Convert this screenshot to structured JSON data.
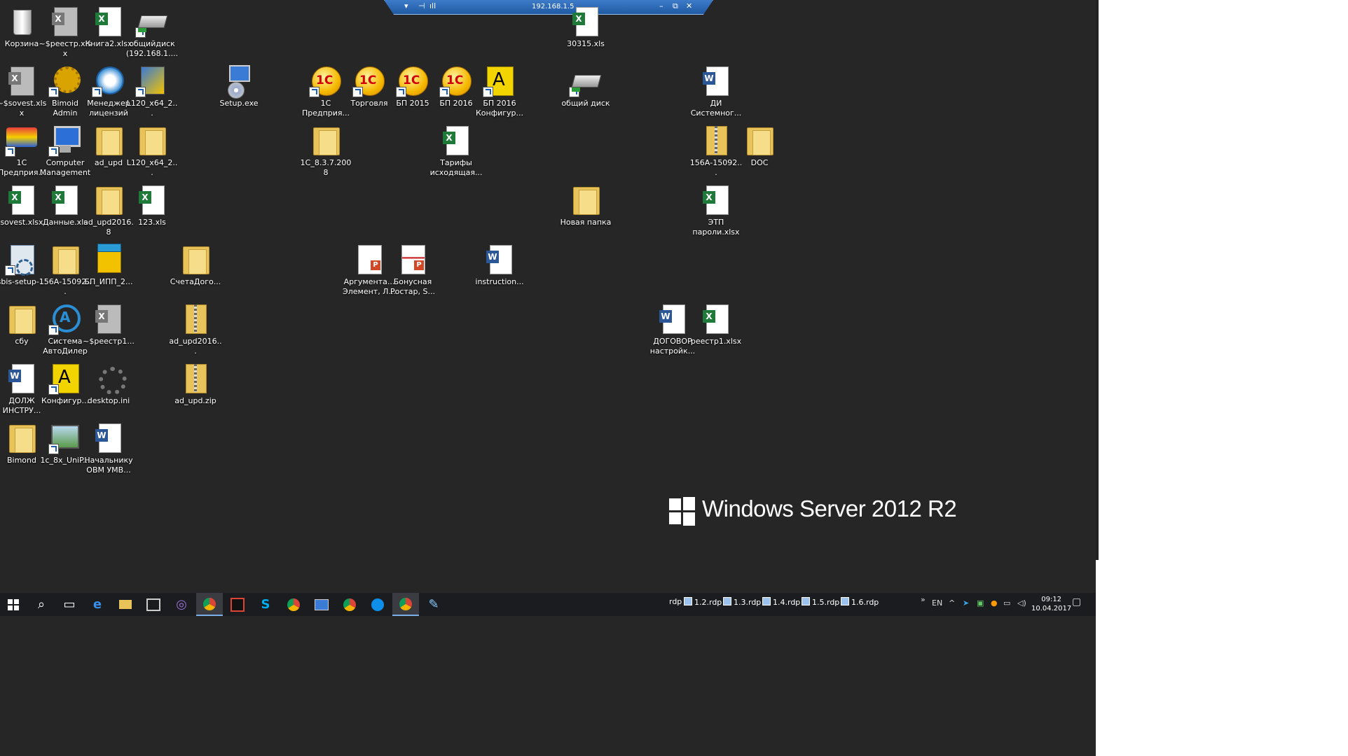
{
  "desktop_icons": [
    {
      "label": "Корзина",
      "type": "recycle"
    },
    {
      "label": "~$реестр.xlsx",
      "type": "excel gray"
    },
    {
      "label": "Книга2.xlsx",
      "type": "excel"
    },
    {
      "label": "общийдиск (192.168.1....",
      "type": "drive"
    },
    {
      "label": "30315.xls",
      "type": "excel"
    },
    {
      "label": "~$sovest.xlsx",
      "type": "excel gray"
    },
    {
      "label": "Bimoid Admin",
      "type": "gear"
    },
    {
      "label": "Менеджер лицензий",
      "type": "license"
    },
    {
      "label": "L120_x64_2...",
      "type": "installer"
    },
    {
      "label": "Setup.exe",
      "type": "setup"
    },
    {
      "label": "1С Предприя...",
      "type": "onec"
    },
    {
      "label": "Торговля",
      "type": "onec"
    },
    {
      "label": "БП 2015",
      "type": "onec"
    },
    {
      "label": "БП 2016",
      "type": "onec"
    },
    {
      "label": "БП 2016 Конфигур...",
      "type": "config"
    },
    {
      "label": "общий диск",
      "type": "drive"
    },
    {
      "label": "ДИ Системног...",
      "type": "word"
    },
    {
      "label": "1С Предприя...",
      "type": "rainbow"
    },
    {
      "label": "Computer Management",
      "type": "pc"
    },
    {
      "label": "ad_upd",
      "type": "folder"
    },
    {
      "label": "L120_x64_2...",
      "type": "folder"
    },
    {
      "label": "1C_8.3.7.2008",
      "type": "folder"
    },
    {
      "label": "Тарифы исходящая...",
      "type": "excel"
    },
    {
      "label": "156А-15092...",
      "type": "zip"
    },
    {
      "label": "DOC",
      "type": "folder"
    },
    {
      "label": "sovest.xlsx",
      "type": "excel"
    },
    {
      "label": "Данные.xls",
      "type": "excel"
    },
    {
      "label": "ad_upd2016.8",
      "type": "folder"
    },
    {
      "label": "123.xls",
      "type": "excel"
    },
    {
      "label": "Новая папка",
      "type": "folder"
    },
    {
      "label": "ЭТП пароли.xlsx",
      "type": "excel"
    },
    {
      "label": "sbis-setup-...",
      "type": "sbis"
    },
    {
      "label": "156А-15092...",
      "type": "folder"
    },
    {
      "label": "БП_ИПП_2...",
      "type": "archive"
    },
    {
      "label": "СчетаДого...",
      "type": "folder"
    },
    {
      "label": "Аргумента... Элемент, Л...",
      "type": "ppt"
    },
    {
      "label": "Бонусная Ростар, S...",
      "type": "ppt red"
    },
    {
      "label": "instruction...",
      "type": "word"
    },
    {
      "label": "сбу",
      "type": "folder"
    },
    {
      "label": "Система АвтоДилер",
      "type": "avto"
    },
    {
      "label": "~$реестр1...",
      "type": "excel gray"
    },
    {
      "label": "ad_upd2016...",
      "type": "zip"
    },
    {
      "label": "ДОГОВОР настройк...",
      "type": "word"
    },
    {
      "label": "реестр1.xlsx",
      "type": "excel"
    },
    {
      "label": "ДОЛЖ ИНСТРУ...",
      "type": "word"
    },
    {
      "label": "Конфигур...",
      "type": "config"
    },
    {
      "label": "desktop.ini",
      "type": "settings"
    },
    {
      "label": "ad_upd.zip",
      "type": "zip"
    },
    {
      "label": "Bimond",
      "type": "folder"
    },
    {
      "label": "1c_8x_UniP...",
      "type": "uni"
    },
    {
      "label": "Начальнику ОВМ УМВ...",
      "type": "word"
    }
  ],
  "rdp_bar": {
    "ip": "192.168.1.5",
    "pin": "⊣",
    "signal": "ıll",
    "minimize": "–",
    "restore": "⧉",
    "close": "✕",
    "menu": "▾"
  },
  "watermark": {
    "text": "Windows Server 2012 R2"
  },
  "taskbar": {
    "rdp_label": "rdp",
    "rdp_items": [
      "1.2.rdp",
      "1.3.rdp",
      "1.4.rdp",
      "1.5.rdp",
      "1.6.rdp"
    ],
    "overflow": "»",
    "language": "EN",
    "time": "09:12",
    "date": "10.04.2017"
  }
}
